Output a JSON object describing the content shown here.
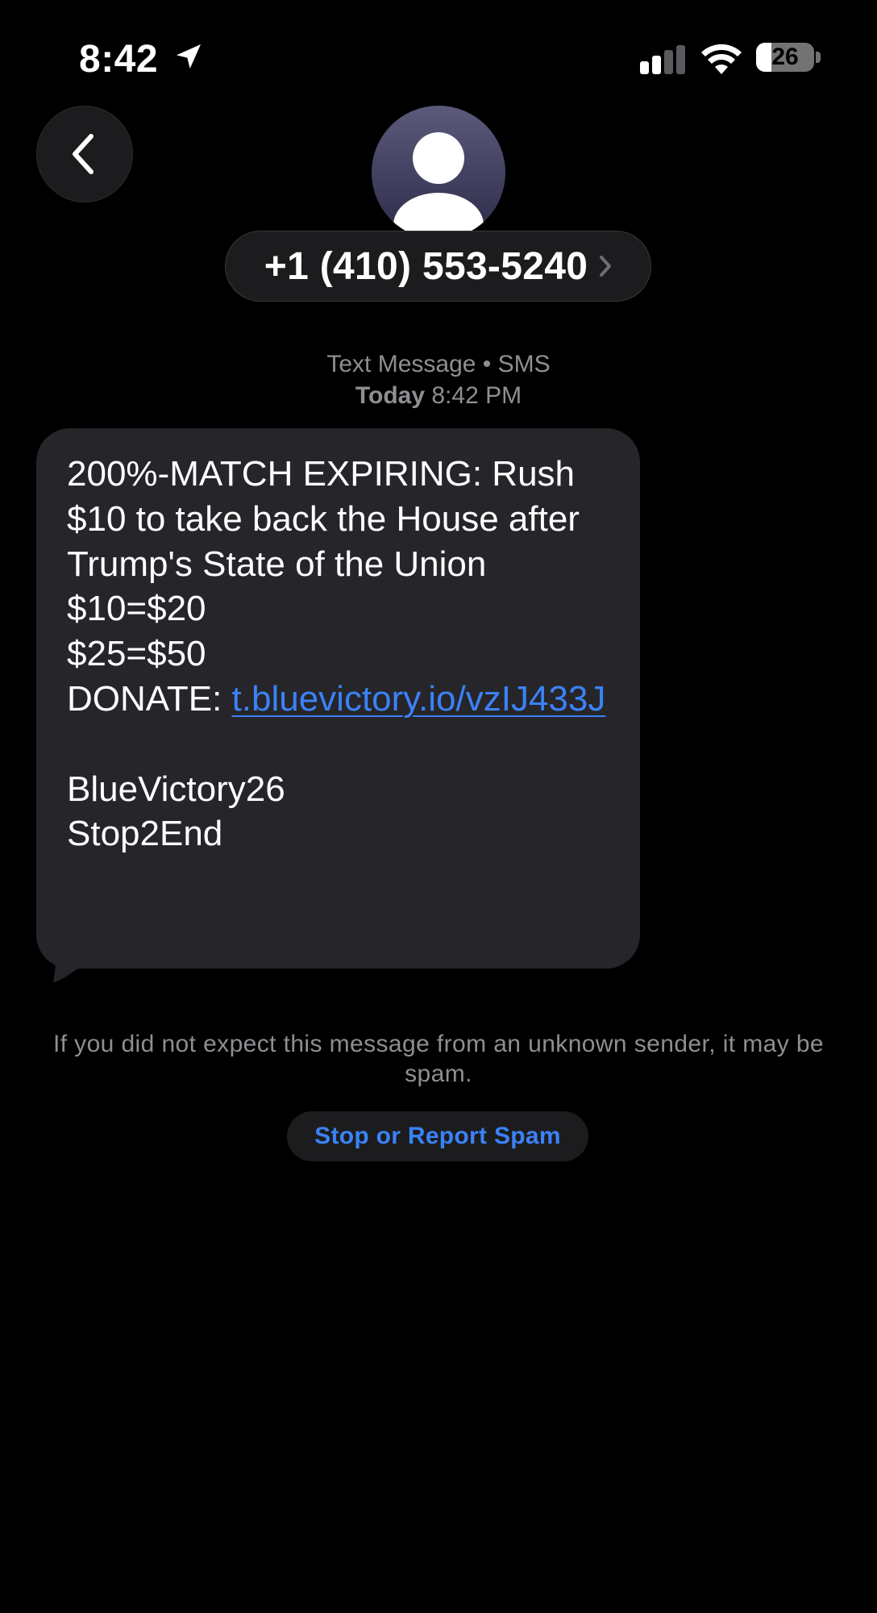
{
  "status_bar": {
    "time": "8:42",
    "battery_level": "26",
    "battery_fraction": 0.26,
    "icons": [
      "location-arrow-icon",
      "cellular-signal-icon",
      "wifi-icon",
      "battery-icon"
    ]
  },
  "header": {
    "back_icon": "chevron-left-icon",
    "avatar_icon": "person-silhouette-icon",
    "contact_number": "+1 (410) 553-5240",
    "contact_chevron_icon": "chevron-right-icon"
  },
  "conversation": {
    "service_label": "Text Message • SMS",
    "day_label": "Today",
    "time_label": "8:42 PM"
  },
  "message": {
    "line_1": "200%-MATCH EXPIRING: Rush $10 to take back the House after Trump's State of the Union",
    "line_2": "$10=$20",
    "line_3": "$25=$50",
    "donate_label": "DONATE: ",
    "link_text": "t.bluevictory.io/vzIJ433J",
    "line_5": "BlueVictory26",
    "line_6": "Stop2End"
  },
  "spam": {
    "notice": "If you did not expect this message from an unknown sender, it may be spam.",
    "button_label": "Stop or Report Spam"
  },
  "colors": {
    "background": "#000000",
    "bubble": "#26252a",
    "link": "#3b82f6",
    "secondary_text": "#8e8e93"
  }
}
